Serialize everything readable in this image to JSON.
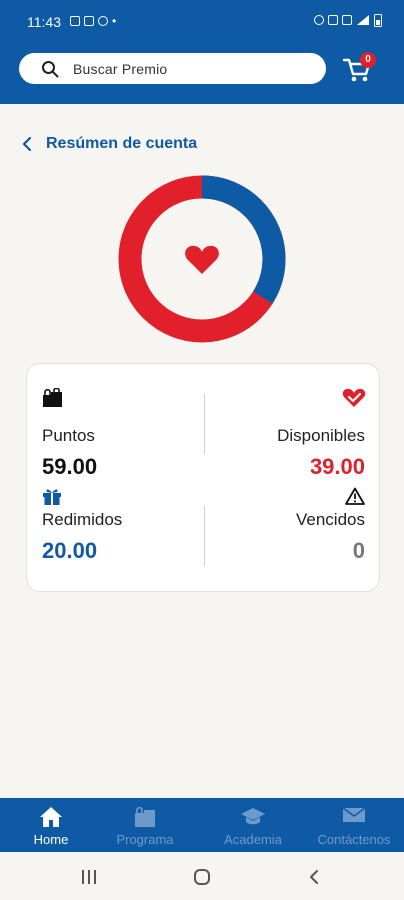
{
  "status_bar": {
    "time": "11:43"
  },
  "search": {
    "placeholder": "Buscar Premio"
  },
  "cart": {
    "badge_count": "0"
  },
  "page": {
    "title": "Resúmen de cuenta"
  },
  "chart": {
    "available_fraction": 0.66,
    "redeemed_fraction": 0.34,
    "colors": {
      "available": "#e2202b",
      "redeemed": "#0f5aa5"
    }
  },
  "summary": {
    "points_label": "Puntos",
    "points_value": "59.00",
    "available_label": "Disponibles",
    "available_value": "39.00",
    "redeemed_label": "Redimidos",
    "redeemed_value": "20.00",
    "expired_label": "Vencidos",
    "expired_value": "0"
  },
  "bottom_nav": {
    "home": "Home",
    "program": "Programa",
    "academy": "Academia",
    "contact": "Contáctenos"
  }
}
